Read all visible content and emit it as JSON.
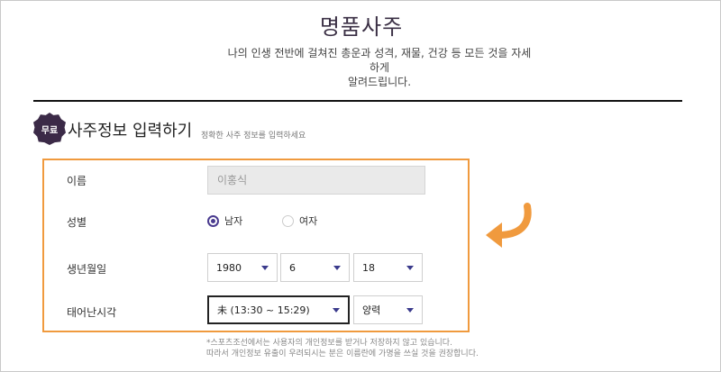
{
  "header": {
    "title": "명품사주",
    "subtitle": "나의 인생 전반에 걸쳐진 총운과 성격, 재물, 건강 등 모든 것을 자세하게\n알려드립니다."
  },
  "section": {
    "badge": "무료",
    "title": "사주정보 입력하기",
    "hint": "정확한 사주 정보를 입력하세요"
  },
  "form": {
    "name": {
      "label": "이름",
      "placeholder": "이홍식"
    },
    "gender": {
      "label": "성별",
      "options": [
        {
          "label": "남자",
          "selected": true
        },
        {
          "label": "여자",
          "selected": false
        }
      ]
    },
    "birthdate": {
      "label": "생년월일",
      "year": "1980",
      "month": "6",
      "day": "18"
    },
    "birthtime": {
      "label": "태어난시각",
      "time": "未 (13:30 ~ 15:29)",
      "calendar": "양력"
    }
  },
  "notice": "*스포츠조선에서는 사용자의 개인정보를 받거나 저장하지 않고 있습니다.\n따라서 개인정보 유출이 우려되시는 분은 이름란에 가명을 쓰실 것을 권장합니다.",
  "colors": {
    "accent": "#f09a3e",
    "brand": "#3b2a47",
    "radio": "#4a3b8f"
  },
  "icons": {
    "arrow": "curved-arrow-icon"
  }
}
